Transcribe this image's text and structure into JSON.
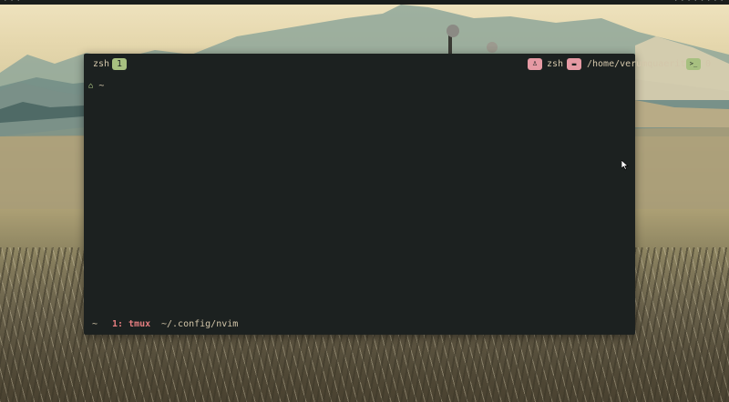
{
  "topbar": {
    "left_text": "• • •",
    "right_text": "• • • • • • • •"
  },
  "terminal": {
    "session_name": "zsh",
    "window_count": "1",
    "user_icon_glyph": "♙",
    "user_name": "zsh",
    "folder_icon_glyph": "▬",
    "path": "/home/verumquaerite",
    "term_icon_glyph": ">_",
    "count": "0",
    "prompt_icon_glyph": "⌂",
    "prompt_text": "~"
  },
  "statusline": {
    "home": "~",
    "active_window": "1: tmux",
    "path": "~/.config/nvim"
  },
  "colors": {
    "terminal_bg": "#1c2120",
    "fg": "#d3c6aa",
    "accent_green": "#a7c080",
    "accent_pink": "#e69aa4",
    "accent_red": "#e67e80"
  },
  "icons": {
    "user": "user-icon",
    "folder": "folder-icon",
    "terminal": "terminal-icon",
    "prompt": "ghost-icon",
    "cursor": "mouse-cursor-icon"
  }
}
